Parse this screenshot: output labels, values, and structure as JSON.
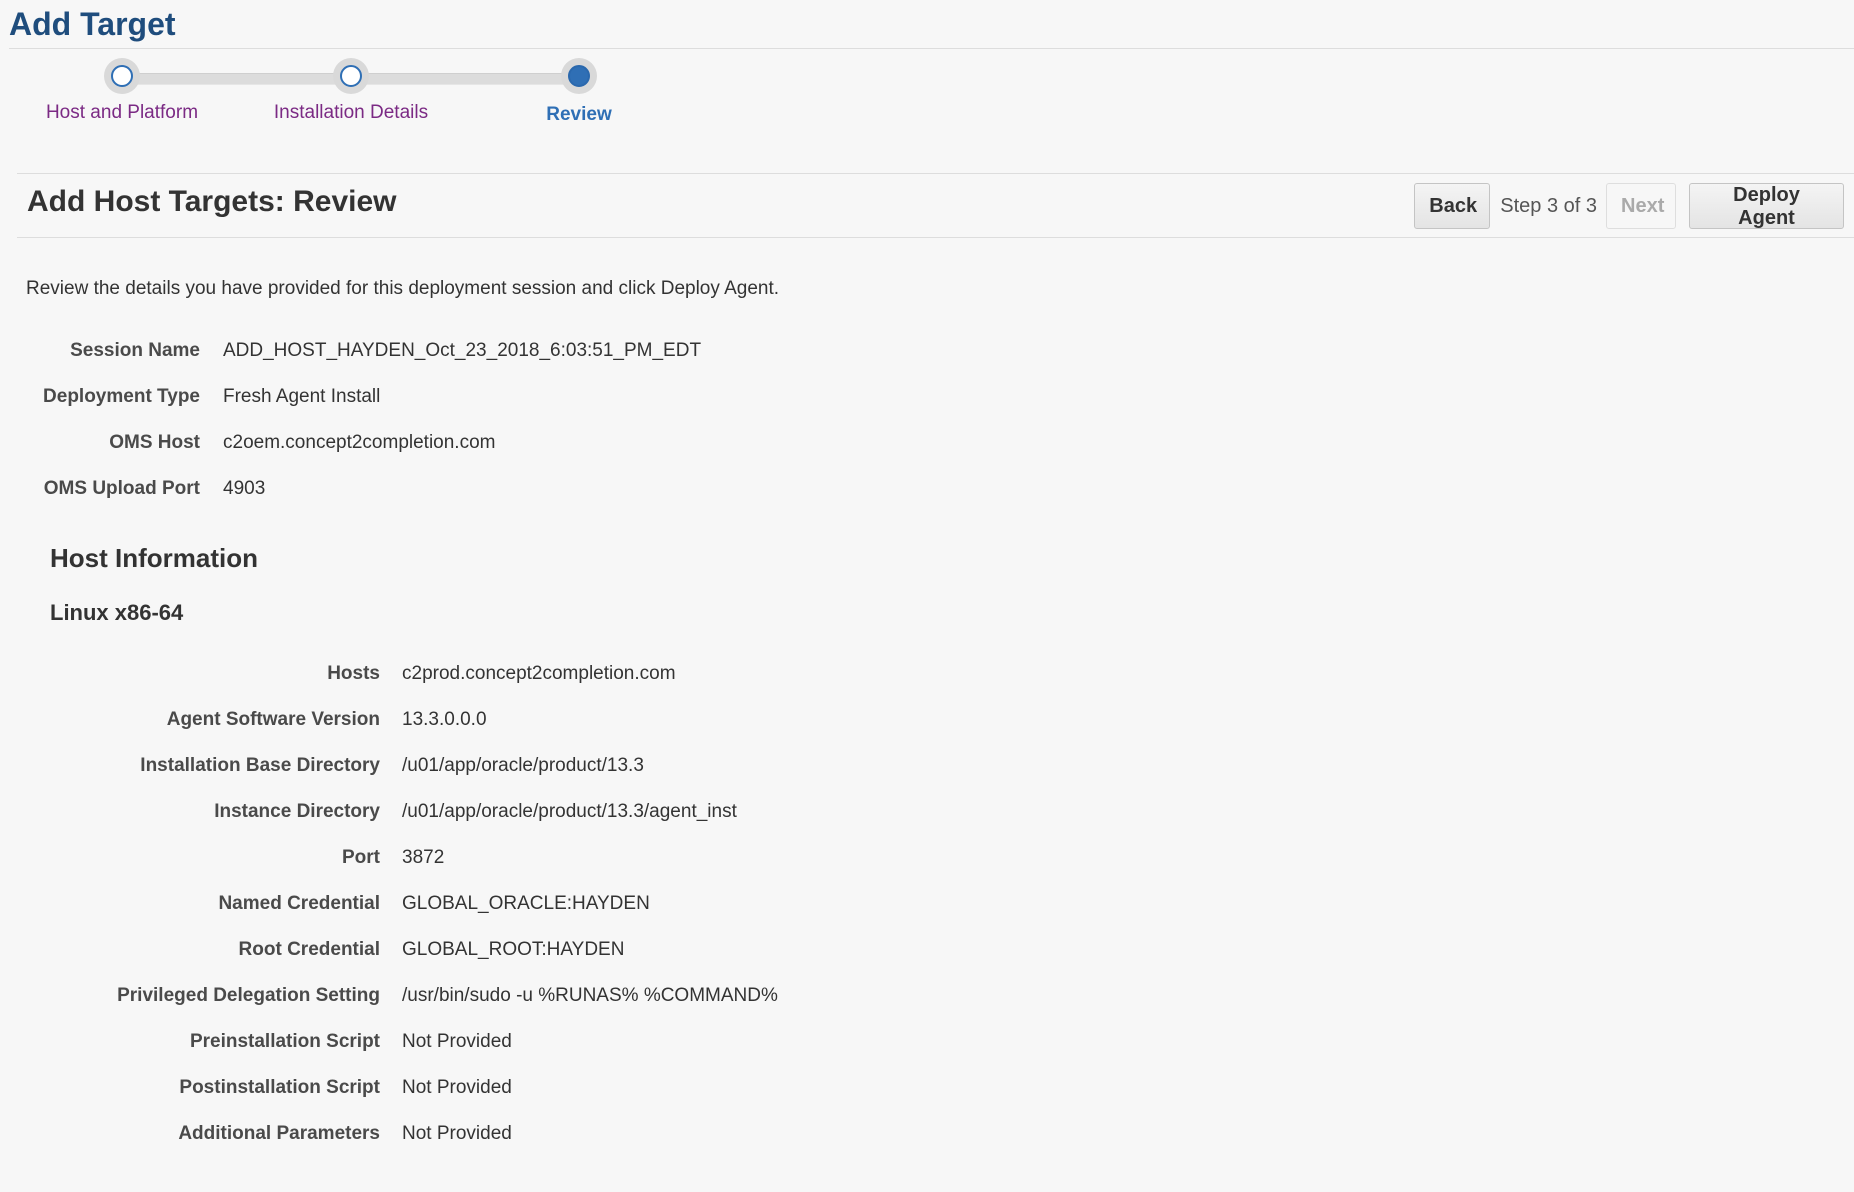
{
  "page": {
    "title": "Add Target"
  },
  "train": {
    "steps": [
      {
        "label": "Host and Platform",
        "state": "visited"
      },
      {
        "label": "Installation Details",
        "state": "visited"
      },
      {
        "label": "Review",
        "state": "current"
      }
    ]
  },
  "section": {
    "title": "Add Host Targets: Review"
  },
  "toolbar": {
    "back_label": "Back",
    "step_text": "Step 3 of 3",
    "next_label": "Next",
    "deploy_label": "Deploy Agent"
  },
  "intro": "Review the details you have provided for this deployment session and click Deploy Agent.",
  "summary": [
    {
      "label": "Session Name",
      "value": "ADD_HOST_HAYDEN_Oct_23_2018_6:03:51_PM_EDT"
    },
    {
      "label": "Deployment Type",
      "value": "Fresh Agent Install"
    },
    {
      "label": "OMS Host",
      "value": "c2oem.concept2completion.com"
    },
    {
      "label": "OMS Upload Port",
      "value": "4903"
    }
  ],
  "host_info": {
    "heading": "Host Information",
    "platform": "Linux x86-64",
    "rows": [
      {
        "label": "Hosts",
        "value": "c2prod.concept2completion.com"
      },
      {
        "label": "Agent Software Version",
        "value": "13.3.0.0.0"
      },
      {
        "label": "Installation Base Directory",
        "value": "/u01/app/oracle/product/13.3"
      },
      {
        "label": "Instance Directory",
        "value": "/u01/app/oracle/product/13.3/agent_inst"
      },
      {
        "label": "Port",
        "value": "3872"
      },
      {
        "label": "Named Credential",
        "value": "GLOBAL_ORACLE:HAYDEN"
      },
      {
        "label": "Root Credential",
        "value": "GLOBAL_ROOT:HAYDEN"
      },
      {
        "label": "Privileged Delegation Setting",
        "value": "/usr/bin/sudo -u %RUNAS% %COMMAND%"
      },
      {
        "label": "Preinstallation Script",
        "value": "Not Provided"
      },
      {
        "label": "Postinstallation Script",
        "value": "Not Provided"
      },
      {
        "label": "Additional Parameters",
        "value": "Not Provided"
      }
    ]
  },
  "colors": {
    "title": "#1f4d7d",
    "train_active": "#2f6fb5",
    "train_link": "#7b2a84",
    "background": "#f7f7f7"
  }
}
